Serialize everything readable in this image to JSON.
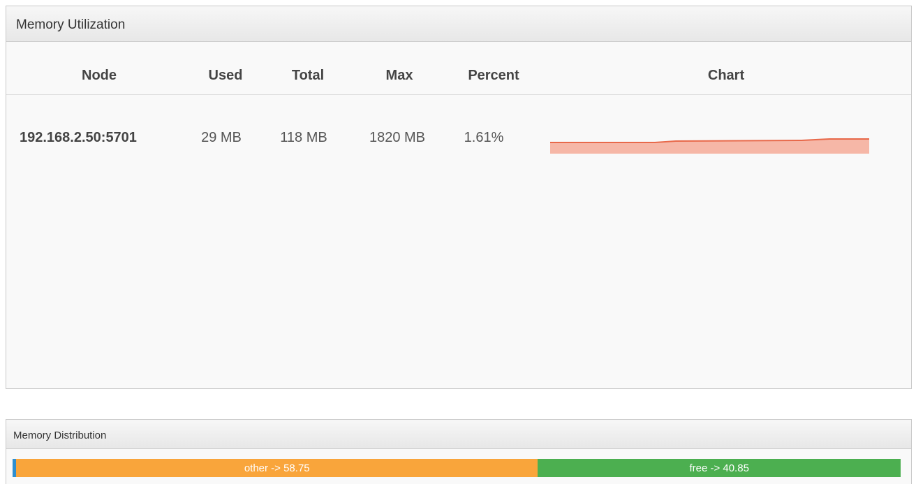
{
  "utilization": {
    "title": "Memory Utilization",
    "columns": {
      "node": "Node",
      "used": "Used",
      "total": "Total",
      "max": "Max",
      "percent": "Percent",
      "chart": "Chart"
    },
    "rows": [
      {
        "node": "192.168.2.50:5701",
        "used": "29 MB",
        "total": "118 MB",
        "max": "1820 MB",
        "percent": "1.61%",
        "chart_color": "#e8694a",
        "chart_fill": "#f6b7a7"
      }
    ]
  },
  "distribution": {
    "title": "Memory Distribution",
    "segments": [
      {
        "name": "used",
        "label": "",
        "value": 0.4,
        "color": "#2f8fd0"
      },
      {
        "name": "other",
        "label": "other -> 58.75",
        "value": 58.75,
        "color": "#f9a53b"
      },
      {
        "name": "free",
        "label": "free -> 40.85",
        "value": 40.85,
        "color": "#4caf50"
      }
    ]
  }
}
